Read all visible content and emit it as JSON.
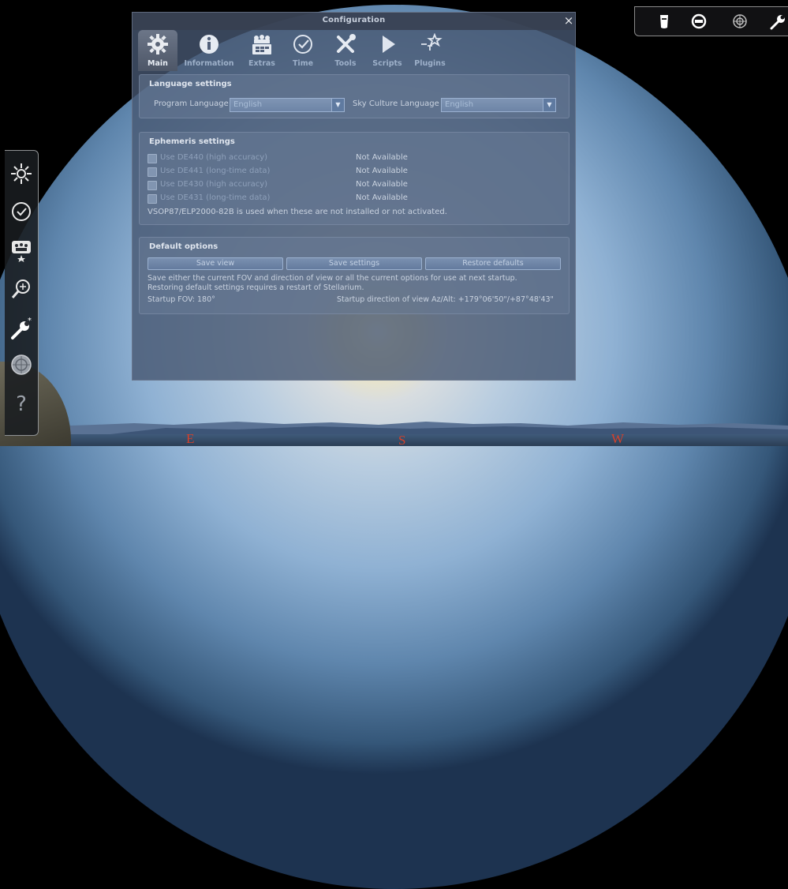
{
  "config_window": {
    "title": "Configuration",
    "close_glyph": "×",
    "tabs": [
      {
        "label": "Main",
        "icon": "gear-icon",
        "active": true
      },
      {
        "label": "Information",
        "icon": "info-icon"
      },
      {
        "label": "Extras",
        "icon": "extras-icon"
      },
      {
        "label": "Time",
        "icon": "clock-icon"
      },
      {
        "label": "Tools",
        "icon": "tools-icon"
      },
      {
        "label": "Scripts",
        "icon": "play-icon"
      },
      {
        "label": "Plugins",
        "icon": "plugins-icon"
      }
    ],
    "language": {
      "title": "Language settings",
      "program_label": "Program Language",
      "program_value": "English",
      "sky_label": "Sky Culture Language",
      "sky_value": "English"
    },
    "ephemeris": {
      "title": "Ephemeris settings",
      "items": [
        {
          "label": "Use DE440 (high accuracy)",
          "status": "Not Available"
        },
        {
          "label": "Use DE441 (long-time data)",
          "status": "Not Available"
        },
        {
          "label": "Use DE430 (high accuracy)",
          "status": "Not Available"
        },
        {
          "label": "Use DE431 (long-time data)",
          "status": "Not Available"
        }
      ],
      "note": "VSOP87/ELP2000-82B is used when these are not installed or not activated."
    },
    "defaults": {
      "title": "Default options",
      "save_view": "Save view",
      "save_settings": "Save settings",
      "restore_defaults": "Restore defaults",
      "desc_line1": "Save either the current FOV and direction of view or all the current options for use at next startup.",
      "desc_line2": "Restoring default settings requires a restart of Stellarium.",
      "startup_fov": "Startup FOV: 180°",
      "startup_direction": "Startup direction of view Az/Alt: +179°06'50\"/+87°48'43\""
    }
  },
  "left_toolbar": [
    {
      "name": "sky-location-icon"
    },
    {
      "name": "date-time-icon"
    },
    {
      "name": "sky-view-icon"
    },
    {
      "name": "search-icon"
    },
    {
      "name": "configuration-icon"
    },
    {
      "name": "astro-calc-icon"
    },
    {
      "name": "help-icon",
      "glyph": "?"
    }
  ],
  "top_right_toolbar": [
    {
      "name": "flashlight-icon"
    },
    {
      "name": "night-mode-icon"
    },
    {
      "name": "fullscreen-icon"
    },
    {
      "name": "wrench-icon"
    }
  ],
  "horizon": {
    "cardinals": {
      "east": "E",
      "south": "S",
      "west": "W"
    }
  },
  "colors": {
    "window_bg": "#46566f",
    "cardinal": "#d4412b",
    "text": "#cad3e0"
  }
}
